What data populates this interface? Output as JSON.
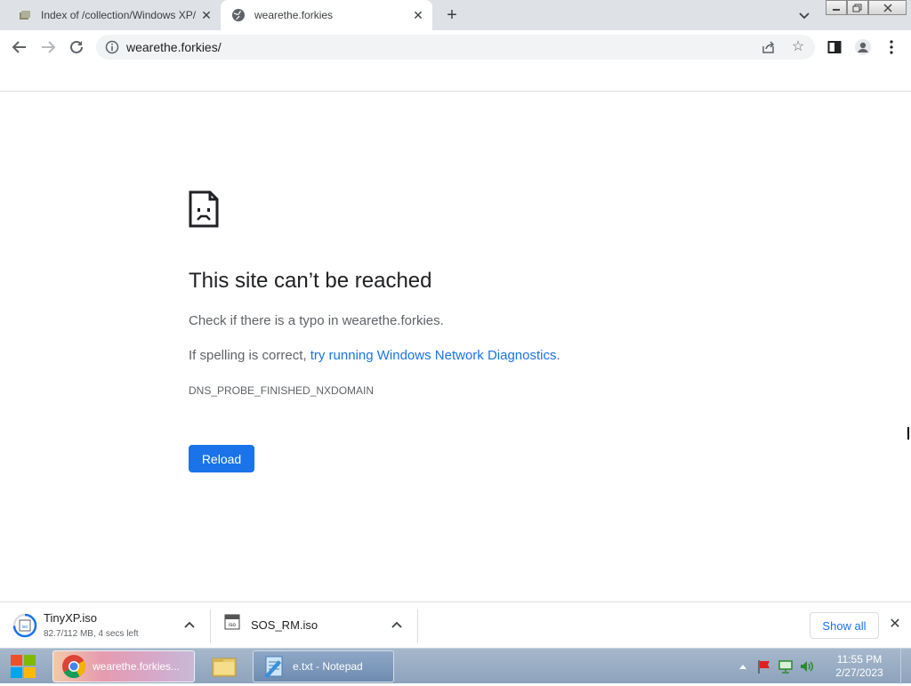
{
  "browser": {
    "tabs": [
      {
        "title": "Index of /collection/Windows XP/",
        "active": false
      },
      {
        "title": "wearethe.forkies",
        "active": true
      }
    ],
    "new_tab": "+",
    "address": "wearethe.forkies/"
  },
  "error_page": {
    "heading": "This site can’t be reached",
    "line1": "Check if there is a typo in wearethe.forkies.",
    "line2_prefix": "If spelling is correct, ",
    "line2_link": "try running Windows Network Diagnostics",
    "line2_suffix": ".",
    "error_code": "DNS_PROBE_FINISHED_NXDOMAIN",
    "reload_label": "Reload"
  },
  "downloads": {
    "items": [
      {
        "name": "TinyXP.iso",
        "status": "82.7/112 MB, 4 secs left",
        "progress_fraction": 0.74
      },
      {
        "name": "SOS_RM.iso",
        "status": ""
      }
    ],
    "show_all_label": "Show all"
  },
  "taskbar": {
    "items": [
      {
        "label": "wearethe.forkies...",
        "app": "chrome-icon"
      },
      {
        "label": "",
        "app": "folder-icon"
      },
      {
        "label": "e.txt - Notepad",
        "app": "notepad-icon"
      }
    ],
    "clock_time": "11:55 PM",
    "clock_date": "2/27/2023"
  },
  "colors": {
    "accent": "#1a73e8",
    "tabstrip": "#dee1e6",
    "omnibox": "#f1f3f4"
  }
}
